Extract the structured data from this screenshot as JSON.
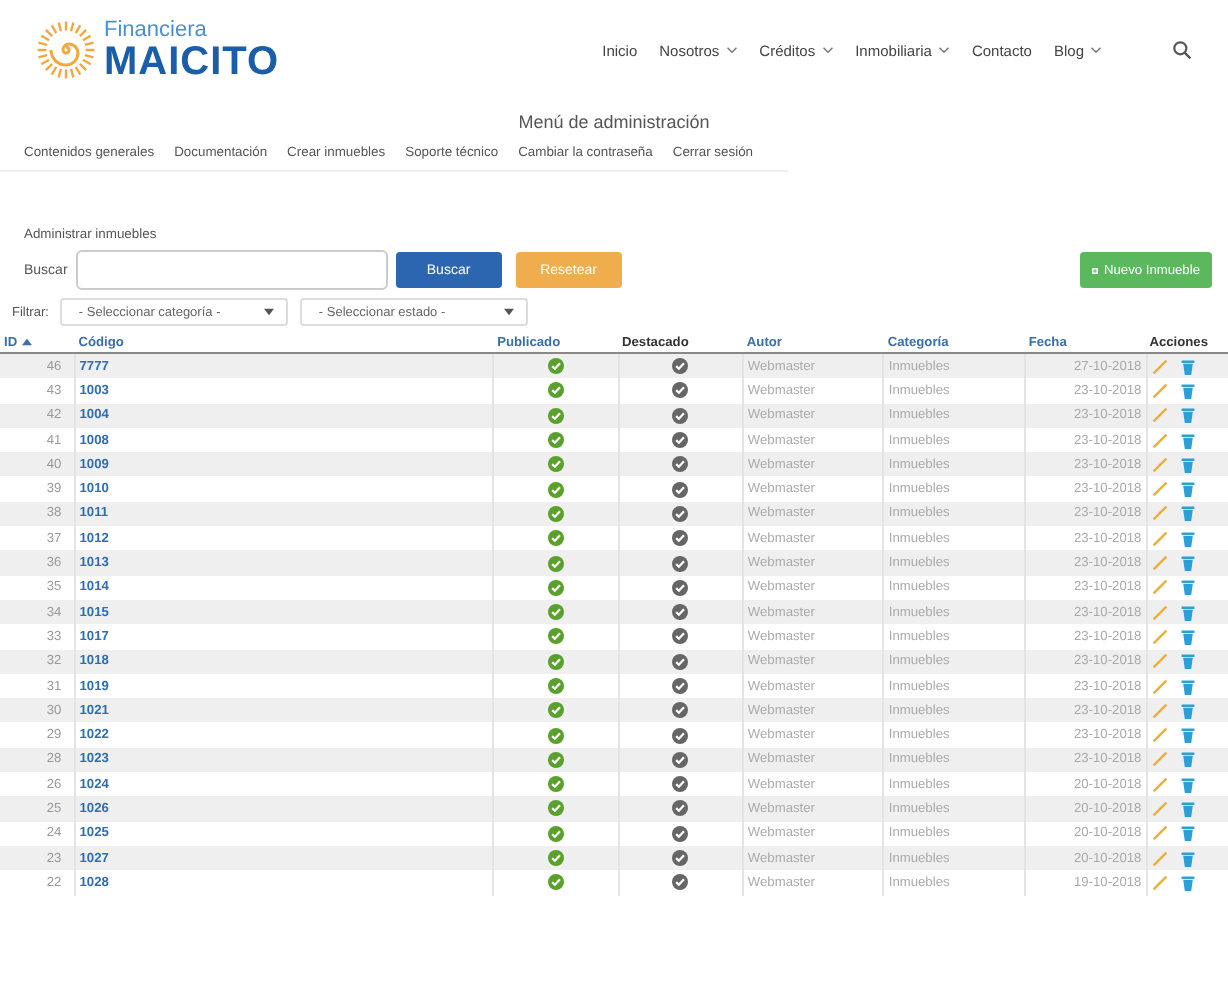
{
  "brand": {
    "top": "Financiera",
    "name": "MAICITO"
  },
  "nav": [
    {
      "label": "Inicio",
      "dropdown": false
    },
    {
      "label": "Nosotros",
      "dropdown": true
    },
    {
      "label": "Créditos",
      "dropdown": true
    },
    {
      "label": "Inmobiliaria",
      "dropdown": true
    },
    {
      "label": "Contacto",
      "dropdown": false
    },
    {
      "label": "Blog",
      "dropdown": true
    }
  ],
  "admin_title": "Menú de administración",
  "admin_menu": [
    "Contenidos generales",
    "Documentación",
    "Crear inmuebles",
    "Soporte técnico",
    "Cambiar la contraseña",
    "Cerrar sesión"
  ],
  "section_title": "Administrar inmuebles",
  "search": {
    "label": "Buscar",
    "button": "Buscar",
    "reset": "Resetear",
    "new": "Nuevo Inmueble"
  },
  "filter": {
    "label": "Filtrar:",
    "category": "- Seleccionar categoría -",
    "state": "- Seleccionar estado -"
  },
  "table": {
    "columns": [
      {
        "label": "ID",
        "sorted": true
      },
      {
        "label": "Código",
        "sorted": false
      },
      {
        "label": "Publicado",
        "sorted": false
      },
      {
        "label": "Destacado",
        "sorted": false
      },
      {
        "label": "Autor",
        "sorted": false
      },
      {
        "label": "Categoría",
        "sorted": false
      },
      {
        "label": "Fecha",
        "sorted": false
      },
      {
        "label": "Acciones",
        "sorted": false
      }
    ],
    "rows": [
      {
        "id": "46",
        "code": "7777",
        "published": true,
        "featured": false,
        "author": "Webmaster",
        "category": "Inmuebles",
        "date": "27-10-2018"
      },
      {
        "id": "43",
        "code": "1003",
        "published": true,
        "featured": false,
        "author": "Webmaster",
        "category": "Inmuebles",
        "date": "23-10-2018"
      },
      {
        "id": "42",
        "code": "1004",
        "published": true,
        "featured": false,
        "author": "Webmaster",
        "category": "Inmuebles",
        "date": "23-10-2018"
      },
      {
        "id": "41",
        "code": "1008",
        "published": true,
        "featured": false,
        "author": "Webmaster",
        "category": "Inmuebles",
        "date": "23-10-2018"
      },
      {
        "id": "40",
        "code": "1009",
        "published": true,
        "featured": false,
        "author": "Webmaster",
        "category": "Inmuebles",
        "date": "23-10-2018"
      },
      {
        "id": "39",
        "code": "1010",
        "published": true,
        "featured": false,
        "author": "Webmaster",
        "category": "Inmuebles",
        "date": "23-10-2018"
      },
      {
        "id": "38",
        "code": "1011",
        "published": true,
        "featured": false,
        "author": "Webmaster",
        "category": "Inmuebles",
        "date": "23-10-2018"
      },
      {
        "id": "37",
        "code": "1012",
        "published": true,
        "featured": false,
        "author": "Webmaster",
        "category": "Inmuebles",
        "date": "23-10-2018"
      },
      {
        "id": "36",
        "code": "1013",
        "published": true,
        "featured": false,
        "author": "Webmaster",
        "category": "Inmuebles",
        "date": "23-10-2018"
      },
      {
        "id": "35",
        "code": "1014",
        "published": true,
        "featured": false,
        "author": "Webmaster",
        "category": "Inmuebles",
        "date": "23-10-2018"
      },
      {
        "id": "34",
        "code": "1015",
        "published": true,
        "featured": false,
        "author": "Webmaster",
        "category": "Inmuebles",
        "date": "23-10-2018"
      },
      {
        "id": "33",
        "code": "1017",
        "published": true,
        "featured": false,
        "author": "Webmaster",
        "category": "Inmuebles",
        "date": "23-10-2018"
      },
      {
        "id": "32",
        "code": "1018",
        "published": true,
        "featured": false,
        "author": "Webmaster",
        "category": "Inmuebles",
        "date": "23-10-2018"
      },
      {
        "id": "31",
        "code": "1019",
        "published": true,
        "featured": false,
        "author": "Webmaster",
        "category": "Inmuebles",
        "date": "23-10-2018"
      },
      {
        "id": "30",
        "code": "1021",
        "published": true,
        "featured": false,
        "author": "Webmaster",
        "category": "Inmuebles",
        "date": "23-10-2018"
      },
      {
        "id": "29",
        "code": "1022",
        "published": true,
        "featured": false,
        "author": "Webmaster",
        "category": "Inmuebles",
        "date": "23-10-2018"
      },
      {
        "id": "28",
        "code": "1023",
        "published": true,
        "featured": false,
        "author": "Webmaster",
        "category": "Inmuebles",
        "date": "23-10-2018"
      },
      {
        "id": "26",
        "code": "1024",
        "published": true,
        "featured": false,
        "author": "Webmaster",
        "category": "Inmuebles",
        "date": "20-10-2018"
      },
      {
        "id": "25",
        "code": "1026",
        "published": true,
        "featured": false,
        "author": "Webmaster",
        "category": "Inmuebles",
        "date": "20-10-2018"
      },
      {
        "id": "24",
        "code": "1025",
        "published": true,
        "featured": false,
        "author": "Webmaster",
        "category": "Inmuebles",
        "date": "20-10-2018"
      },
      {
        "id": "23",
        "code": "1027",
        "published": true,
        "featured": false,
        "author": "Webmaster",
        "category": "Inmuebles",
        "date": "20-10-2018"
      },
      {
        "id": "22",
        "code": "1028",
        "published": true,
        "featured": false,
        "author": "Webmaster",
        "category": "Inmuebles",
        "date": "19-10-2018"
      }
    ]
  }
}
